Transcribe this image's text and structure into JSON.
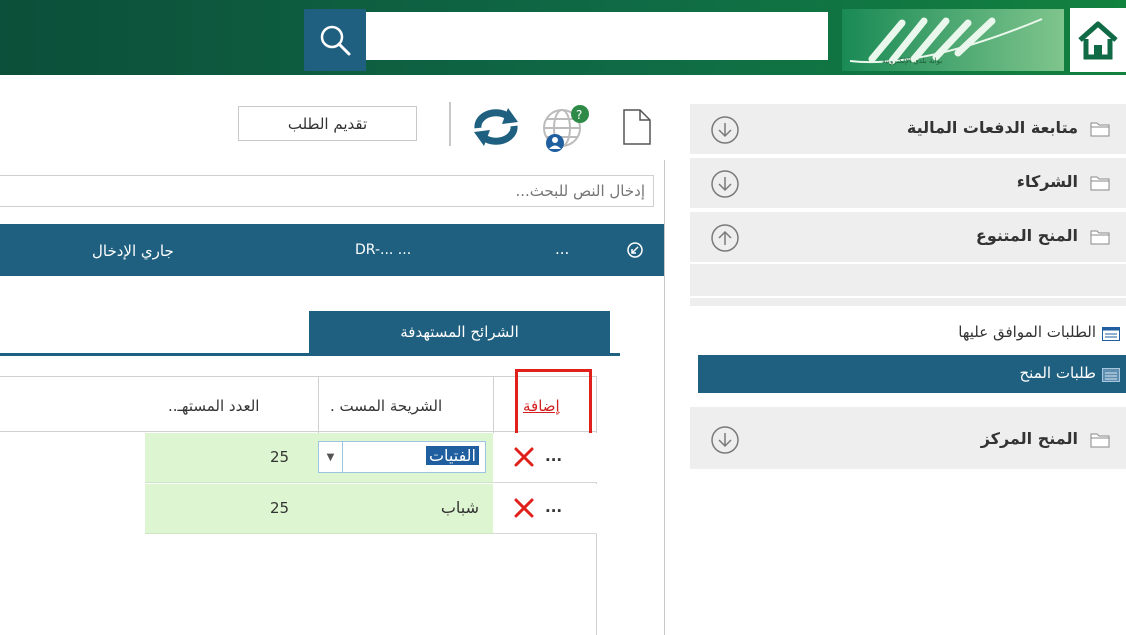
{
  "header": {
    "search_placeholder": "",
    "logo_caption": "بوابة بلدي الإلكترونية",
    "colors": {
      "bar": "#0f6a45",
      "search_button": "#1f5f7f"
    }
  },
  "sidebar": {
    "items": [
      {
        "label": "متابعة الدفعات المالية",
        "state": "collapsed"
      },
      {
        "label": "الشركاء",
        "state": "collapsed"
      },
      {
        "label": "المنح المتنوع",
        "state": "expanded"
      },
      {
        "label": "المنح المركز",
        "state": "collapsed"
      }
    ],
    "sub_items": [
      {
        "label": "الطلبات الموافق عليها",
        "selected": false
      },
      {
        "label": "طلبات المنح",
        "selected": true
      }
    ]
  },
  "toolbar": {
    "submit_label": "تقديم الطلب",
    "icons": [
      "document-icon",
      "globe-user-icon",
      "refresh-icon"
    ]
  },
  "main": {
    "search_placeholder": "إدخال النص للبحث...",
    "record": {
      "id": "DR-... ...",
      "more": "...",
      "status": "جاري الإدخال"
    },
    "tab": "الشرائح المستهدفة",
    "grid": {
      "add_label": "إضافة",
      "columns": [
        "الشريحة المست .",
        "العدد المستهـ.."
      ],
      "rows": [
        {
          "segment": "الفتيات",
          "count": "25",
          "more": "..."
        },
        {
          "segment": "شباب",
          "count": "25",
          "more": "..."
        }
      ]
    }
  },
  "colors": {
    "accent": "#1f5f7f",
    "row_highlight": "#ddf5d0",
    "alert": "#e0201a"
  }
}
